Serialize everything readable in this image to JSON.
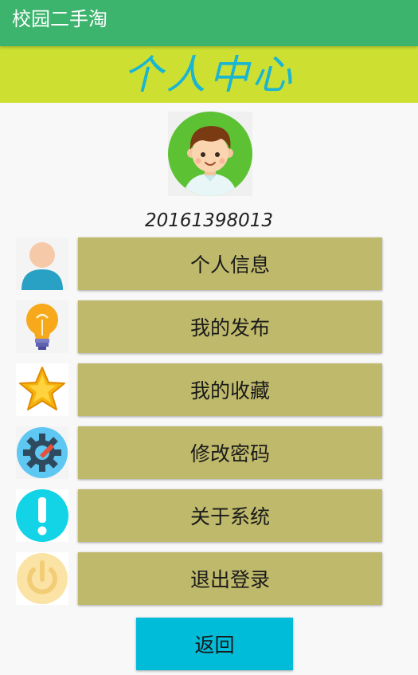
{
  "app": {
    "title": "校园二手淘"
  },
  "header": {
    "title": "个人中心"
  },
  "profile": {
    "user_id": "20161398013"
  },
  "menu": {
    "items": [
      {
        "label": "个人信息",
        "icon": "user-icon"
      },
      {
        "label": "我的发布",
        "icon": "lightbulb-icon"
      },
      {
        "label": "我的收藏",
        "icon": "star-icon"
      },
      {
        "label": "修改密码",
        "icon": "gear-wrench-icon"
      },
      {
        "label": "关于系统",
        "icon": "exclamation-icon"
      },
      {
        "label": "退出登录",
        "icon": "power-icon"
      }
    ]
  },
  "footer": {
    "back_label": "返回"
  },
  "colors": {
    "appbar": "#3db46e",
    "header_band": "#cde032",
    "header_text": "#1ab5d2",
    "menu_button": "#bfb96b",
    "back_button": "#00bcd8"
  }
}
